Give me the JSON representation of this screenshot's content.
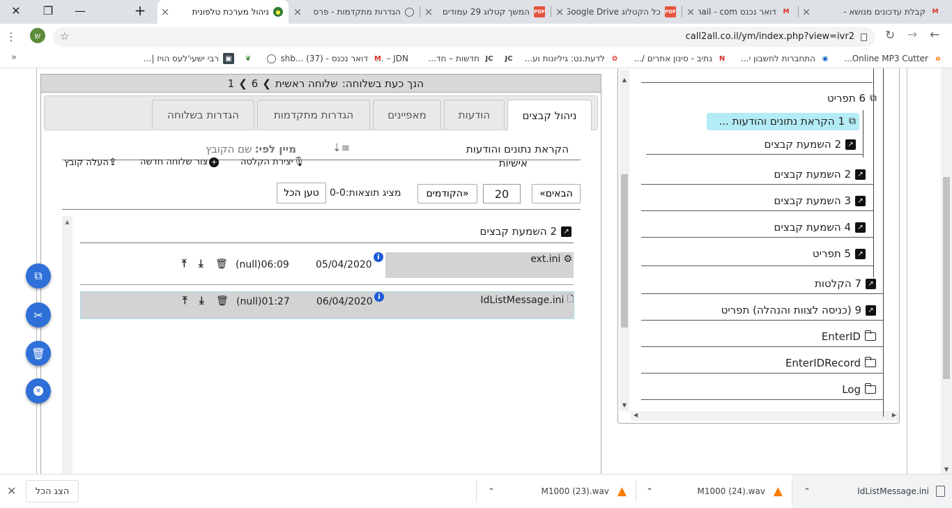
{
  "tabs": [
    {
      "title": "קבלת עדכונים מנושא - ",
      "favicon": "gmail-icon",
      "active": false
    },
    {
      "title": "דואר נכנס Gmail - com.",
      "favicon": "gmail-icon",
      "active": false
    },
    {
      "title": "כל הקטלוג Google Drive",
      "favicon": "pdf-icon",
      "active": false
    },
    {
      "title": "המשך קטלוג 29 עמודים",
      "favicon": "pdf-icon",
      "active": false
    },
    {
      "title": "הגדרות מתקדמות - פרס",
      "favicon": "globe-icon",
      "active": false
    },
    {
      "title": "ניהול מערכת טלפונית",
      "favicon": "site-icon",
      "active": true
    }
  ],
  "address": {
    "url": "call2all.co.il/ym/index.php?view=ivr2",
    "profile_initial": "ש"
  },
  "bookmarks": [
    {
      "label": "Online MP3 Cutter...",
      "icon": "mp3-icon"
    },
    {
      "label": "התחברות לחשבון י...",
      "icon": "bank-icon"
    },
    {
      "label": "נתיב - סינון אתרים /...",
      "icon": "netiv-icon"
    },
    {
      "label": "לדעת.נט: גיליונות וע...",
      "icon": "huawei-icon"
    },
    {
      "label": "",
      "icon": "jdn-icon"
    },
    {
      "label": "חדשות – חד...",
      "icon": "jdn-icon"
    },
    {
      "label": "JDN – ...",
      "icon": ""
    },
    {
      "label": "דואר נכנס - shb... (37)",
      "icon": "gmail-icon"
    },
    {
      "label": "",
      "icon": "globe-icon"
    },
    {
      "label": "",
      "icon": "leaf-icon"
    },
    {
      "label": "רבי ישעי'לעס הויז |...",
      "icon": "photo-icon"
    }
  ],
  "breadcrumb": {
    "prefix": "הנך כעת בשלוחה:",
    "name": "שלוחה ראשית",
    "path1": "6",
    "path2": "1"
  },
  "ui_tabs": [
    "ניהול קבצים",
    "הודעות",
    "מאפיינים",
    "הגדרות מתקדמות",
    "הגדרות בשלוחה"
  ],
  "toolbar": {
    "title": "הקראת נתונים והודעות",
    "subtitle": "אישיות",
    "sort_label": "מיין לפי:",
    "sort_value": "שם הקובץ",
    "record_label": "יצירת הקלטה",
    "new_ext_label": "צור שלוחה חדשה",
    "upload_label": "העלה קובץ"
  },
  "pager": {
    "next_label": "«הבאים",
    "count": "20",
    "prev_label": "הקודמים»",
    "shows": "מציג תוצאות:0-0",
    "load_all": "טען הכל"
  },
  "folder": {
    "num": "2",
    "label": "השמעת קבצים"
  },
  "files": [
    {
      "name": "ext.ini",
      "date": "05/04/2020",
      "time": "06:09",
      "size": "(null)",
      "icon": "gear-icon"
    },
    {
      "name": "IdListMessage.ini",
      "date": "06/04/2020",
      "time": "01:27",
      "size": "(null)",
      "icon": "text-file-icon"
    }
  ],
  "tree": [
    {
      "label": "6 תפריט",
      "icon": "external-link-icon"
    },
    {
      "label": "1 הקראת נתונים והודעות ...",
      "icon": "external-link-icon",
      "selected": true
    },
    {
      "label": "2 השמעת קבצים",
      "icon": "shortcut-icon"
    },
    {
      "label": "2 השמעת קבצים",
      "icon": "shortcut-icon"
    },
    {
      "label": "3 השמעת קבצים",
      "icon": "shortcut-icon"
    },
    {
      "label": "4 השמעת קבצים",
      "icon": "shortcut-icon"
    },
    {
      "label": "5 תפריט",
      "icon": "shortcut-icon"
    },
    {
      "label": "7 הקלטות",
      "icon": "shortcut-icon"
    },
    {
      "label": "9 (כניסה לצוות והנהלה) תפריט",
      "icon": "shortcut-icon"
    },
    {
      "label": "EnterID",
      "icon": "folder-icon"
    },
    {
      "label": "EnterIDRecord",
      "icon": "folder-icon"
    },
    {
      "label": "Log",
      "icon": "folder-icon"
    }
  ],
  "downloads": [
    {
      "name": "IdListMessage.ini",
      "icon": "file-icon"
    },
    {
      "name": "M1000 (24).wav",
      "icon": "vlc-icon"
    },
    {
      "name": "M1000 (23).wav",
      "icon": "vlc-icon"
    }
  ],
  "download_bar": {
    "show_all": "הצג הכל"
  },
  "colors": {
    "tab_strip": "#dee1e6",
    "selected_tree": "#b3ecf5",
    "fab": "#2f6fd8",
    "row_hover": "#d3d3d3"
  }
}
